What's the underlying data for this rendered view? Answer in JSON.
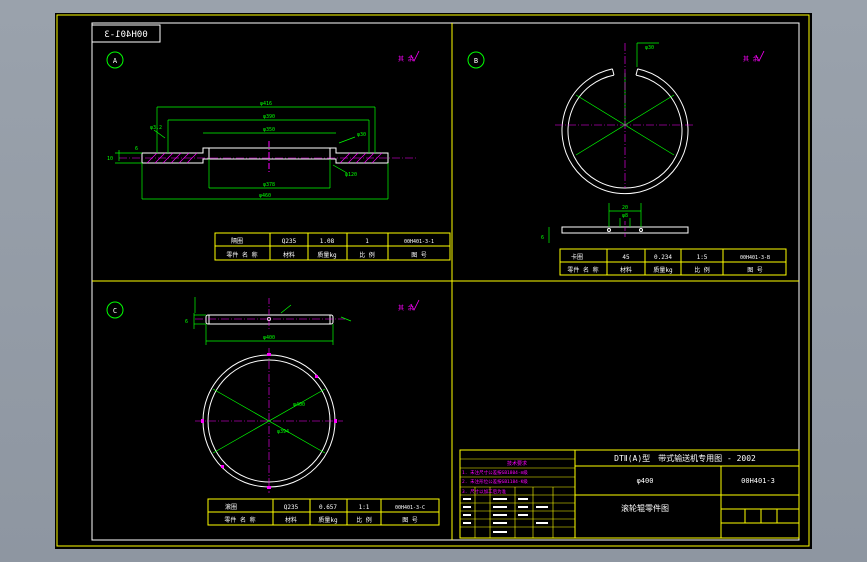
{
  "drawing": {
    "drawing_no_mirrored": "00H401-3",
    "title_main": "DTⅡ(A)型　带式输送机专用图 - 2002",
    "part_spec": "φ400",
    "part_code": "00H401-3",
    "part_title": "滚轮辊零件图"
  },
  "views": {
    "a": {
      "label": "A",
      "mark": "其 余",
      "dims": [
        "φ416",
        "φ390",
        "φ350",
        "φ378",
        "φ460",
        "φ30",
        "φ3.2",
        "φ120",
        "10",
        "6"
      ],
      "table": {
        "row1": [
          "隔圈",
          "Q235",
          "1.08",
          "1",
          "00H401-3-1"
        ],
        "row2": [
          "零件 名 称",
          "材料",
          "质量kg",
          "比 例",
          "图 号"
        ]
      }
    },
    "b": {
      "label": "B",
      "mark": "其 余",
      "dims": [
        "20",
        "φ30",
        "φ8",
        "6"
      ],
      "table": {
        "row1": [
          "卡圈",
          "45",
          "0.234",
          "1:5",
          "00H401-3-B"
        ],
        "row2": [
          "零件 名 称",
          "材料",
          "质量kg",
          "比 例",
          "图 号"
        ]
      }
    },
    "c": {
      "label": "C",
      "mark": "其 余",
      "dims": [
        "φ400",
        "φ394",
        "6"
      ],
      "table": {
        "row1": [
          "滚圈",
          "Q235",
          "0.657",
          "1:1",
          "00H401-3-C"
        ],
        "row2": [
          "零件 名 称",
          "材料",
          "质量kg",
          "比 例",
          "图 号"
        ]
      }
    }
  },
  "notes": {
    "title": "技术要求",
    "lines": [
      "1. 未注尺寸公差按GB1804-m级",
      "2. 未注形位公差按GB1184-K级",
      "3. 尺寸以加工后为准"
    ]
  }
}
